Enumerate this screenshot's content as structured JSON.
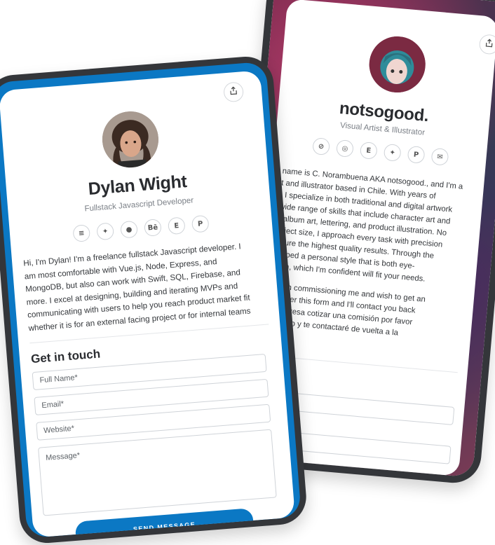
{
  "back_profile": {
    "name": "notsogood.",
    "subtitle": "Visual Artist & Illustrator",
    "socials": [
      {
        "icon": "link-icon",
        "glyph": "⊘"
      },
      {
        "icon": "instagram-icon",
        "glyph": "◎"
      },
      {
        "icon": "etsy-icon",
        "glyph": "E"
      },
      {
        "icon": "twitter-icon",
        "glyph": "✦"
      },
      {
        "icon": "paypal-icon",
        "glyph": "P"
      },
      {
        "icon": "email-icon",
        "glyph": "✉"
      }
    ],
    "bio_lines": [
      "name is C. Norambuena AKA notsogood., and I'm a",
      "t and illustrator based in Chile. With years of",
      ". I specialize in both traditional and digital artwork",
      "wide range of skills that include character art and",
      "r/album art, lettering, and product illustration. No",
      "roject size, I approach every task with precision",
      "nsure the highest quality results. Through the",
      "eloped a personal style that is both eye-",
      "lean, which I'm confident will fit your needs."
    ],
    "bio2_lines": [
      "ted in commissioning me and wish to get an",
      "answer this form and I'll contact you back",
      "e interesa cotizar una comisión por favor",
      "mulario y te contactaré de vuelta a la"
    ]
  },
  "front_profile": {
    "name": "Dylan Wight",
    "subtitle": "Fullstack Javascript Developer",
    "socials": [
      {
        "icon": "stackoverflow-icon",
        "glyph": "≡"
      },
      {
        "icon": "twitter-icon",
        "glyph": "✦"
      },
      {
        "icon": "reddit-icon",
        "glyph": "●"
      },
      {
        "icon": "behance-icon",
        "glyph": "Bē"
      },
      {
        "icon": "etsy-icon",
        "glyph": "E"
      },
      {
        "icon": "paypal-icon",
        "glyph": "P"
      }
    ],
    "bio_lines": [
      "Hi, I'm Dylan! I'm a freelance fullstack Javascript developer. I",
      "am most comfortable with Vue.js, Node, Express, and",
      "MongoDB, but also can work with Swift, SQL, Firebase, and",
      "more. I excel at designing, building and iterating MVPs and",
      "communicating with users to help you reach product market fit",
      "whether it is for an external facing project or for internal teams"
    ]
  },
  "contact_form": {
    "heading": "Get in touch",
    "full_name_placeholder": "Full Name*",
    "email_placeholder": "Email*",
    "website_placeholder": "Website*",
    "message_placeholder": "Message*",
    "send_label": "SEND MESSAGE"
  },
  "colors": {
    "accent": "#0b78c4",
    "bezel": "#34363a",
    "text": "#2a2c30"
  }
}
